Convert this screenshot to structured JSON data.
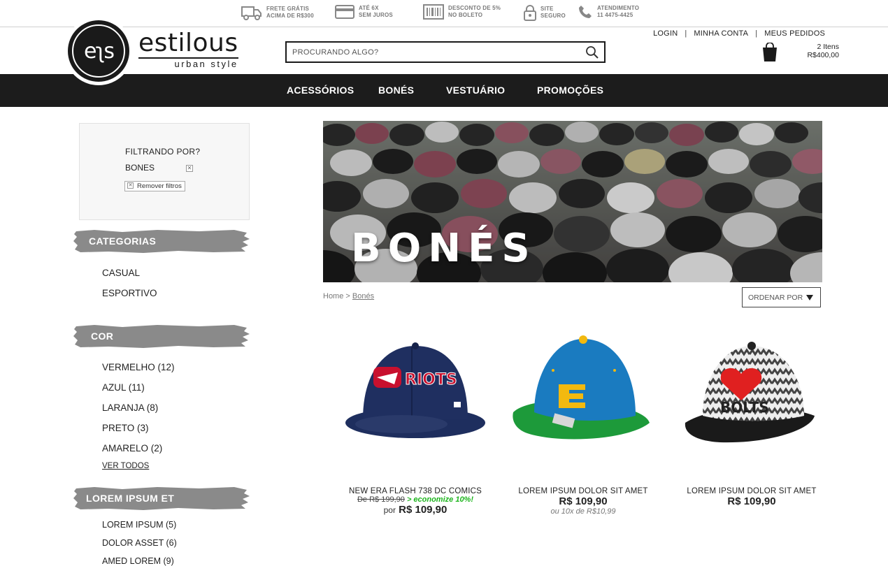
{
  "topbar": {
    "items": [
      {
        "icon": "truck-icon",
        "line1": "FRETE GRÁTIS",
        "line2": "ACIMA DE R$300"
      },
      {
        "icon": "credit-card-icon",
        "line1": "ATÉ 6X",
        "line2": "SEM JUROS"
      },
      {
        "icon": "barcode-icon",
        "line1": "DESCONTO DE 5%",
        "line2": "NO BOLETO"
      },
      {
        "icon": "lock-icon",
        "line1": "SITE",
        "line2": "SEGURO"
      },
      {
        "icon": "phone-icon",
        "line1": "ATENDIMENTO",
        "line2": "11 4475-4425"
      }
    ]
  },
  "header": {
    "logo_mark": "eʅs",
    "brand_name": "estilous",
    "brand_tagline": "urban style",
    "search_placeholder": "PROCURANDO ALGO?",
    "links": {
      "login": "LOGIN",
      "account": "MINHA CONTA",
      "orders": "MEUS PEDIDOS",
      "separator": "|"
    },
    "cart": {
      "items": "2 Itens",
      "total": "R$400,00"
    }
  },
  "nav": {
    "items": [
      "ACESSÓRIOS",
      "BONÉS",
      "VESTUÁRIO",
      "PROMOÇÕES"
    ]
  },
  "filters": {
    "title": "FILTRANDO POR?",
    "active": "BONES",
    "remove_label": "Remover filtros",
    "x_mark": "✕"
  },
  "sidebar": {
    "categories": {
      "title": "CATEGORIAS",
      "items": [
        "CASUAL",
        "ESPORTIVO"
      ]
    },
    "color": {
      "title": "COR",
      "items": [
        "VERMELHO  (12)",
        "AZUL (11)",
        "LARANJA  (8)",
        "PRETO  (3)",
        "AMARELO (2)"
      ],
      "see_all": "VER TODOS"
    },
    "other": {
      "title": "LOREM IPSUM ET",
      "items": [
        "LOREM IPSUM (5)",
        "DOLOR ASSET (6)",
        "AMED LOREM (9)"
      ]
    }
  },
  "banner": {
    "title": "BONÉS"
  },
  "breadcrumb": {
    "home": "Home",
    "sep": ">",
    "current": "Bonés"
  },
  "sort": {
    "label": "ORDENAR POR"
  },
  "products": [
    {
      "name": "NEW ERA FLASH 738 DC COMICS",
      "old_price": "De R$ 199,90",
      "discount": "> economize 10%!",
      "prefix": "por",
      "price": "R$ 109,90"
    },
    {
      "name": "LOREM IPSUM DOLOR SIT AMET",
      "price": "R$ 109,90",
      "installments": "ou 10x de R$10,99"
    },
    {
      "name": "LOREM IPSUM DOLOR SIT AMET",
      "price": "R$ 109,90"
    }
  ],
  "colors": {
    "nav_bg": "#1c1c1c",
    "discount_green": "#1eb51e",
    "brush_gray": "#8a8a8a"
  }
}
